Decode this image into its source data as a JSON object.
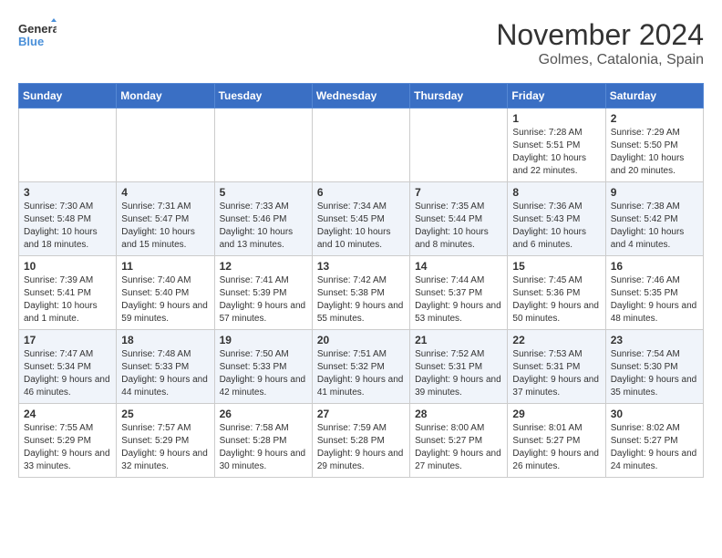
{
  "header": {
    "logo_line1": "General",
    "logo_line2": "Blue",
    "month": "November 2024",
    "location": "Golmes, Catalonia, Spain"
  },
  "weekdays": [
    "Sunday",
    "Monday",
    "Tuesday",
    "Wednesday",
    "Thursday",
    "Friday",
    "Saturday"
  ],
  "weeks": [
    [
      {
        "day": "",
        "content": ""
      },
      {
        "day": "",
        "content": ""
      },
      {
        "day": "",
        "content": ""
      },
      {
        "day": "",
        "content": ""
      },
      {
        "day": "",
        "content": ""
      },
      {
        "day": "1",
        "content": "Sunrise: 7:28 AM\nSunset: 5:51 PM\nDaylight: 10 hours and 22 minutes."
      },
      {
        "day": "2",
        "content": "Sunrise: 7:29 AM\nSunset: 5:50 PM\nDaylight: 10 hours and 20 minutes."
      }
    ],
    [
      {
        "day": "3",
        "content": "Sunrise: 7:30 AM\nSunset: 5:48 PM\nDaylight: 10 hours and 18 minutes."
      },
      {
        "day": "4",
        "content": "Sunrise: 7:31 AM\nSunset: 5:47 PM\nDaylight: 10 hours and 15 minutes."
      },
      {
        "day": "5",
        "content": "Sunrise: 7:33 AM\nSunset: 5:46 PM\nDaylight: 10 hours and 13 minutes."
      },
      {
        "day": "6",
        "content": "Sunrise: 7:34 AM\nSunset: 5:45 PM\nDaylight: 10 hours and 10 minutes."
      },
      {
        "day": "7",
        "content": "Sunrise: 7:35 AM\nSunset: 5:44 PM\nDaylight: 10 hours and 8 minutes."
      },
      {
        "day": "8",
        "content": "Sunrise: 7:36 AM\nSunset: 5:43 PM\nDaylight: 10 hours and 6 minutes."
      },
      {
        "day": "9",
        "content": "Sunrise: 7:38 AM\nSunset: 5:42 PM\nDaylight: 10 hours and 4 minutes."
      }
    ],
    [
      {
        "day": "10",
        "content": "Sunrise: 7:39 AM\nSunset: 5:41 PM\nDaylight: 10 hours and 1 minute."
      },
      {
        "day": "11",
        "content": "Sunrise: 7:40 AM\nSunset: 5:40 PM\nDaylight: 9 hours and 59 minutes."
      },
      {
        "day": "12",
        "content": "Sunrise: 7:41 AM\nSunset: 5:39 PM\nDaylight: 9 hours and 57 minutes."
      },
      {
        "day": "13",
        "content": "Sunrise: 7:42 AM\nSunset: 5:38 PM\nDaylight: 9 hours and 55 minutes."
      },
      {
        "day": "14",
        "content": "Sunrise: 7:44 AM\nSunset: 5:37 PM\nDaylight: 9 hours and 53 minutes."
      },
      {
        "day": "15",
        "content": "Sunrise: 7:45 AM\nSunset: 5:36 PM\nDaylight: 9 hours and 50 minutes."
      },
      {
        "day": "16",
        "content": "Sunrise: 7:46 AM\nSunset: 5:35 PM\nDaylight: 9 hours and 48 minutes."
      }
    ],
    [
      {
        "day": "17",
        "content": "Sunrise: 7:47 AM\nSunset: 5:34 PM\nDaylight: 9 hours and 46 minutes."
      },
      {
        "day": "18",
        "content": "Sunrise: 7:48 AM\nSunset: 5:33 PM\nDaylight: 9 hours and 44 minutes."
      },
      {
        "day": "19",
        "content": "Sunrise: 7:50 AM\nSunset: 5:33 PM\nDaylight: 9 hours and 42 minutes."
      },
      {
        "day": "20",
        "content": "Sunrise: 7:51 AM\nSunset: 5:32 PM\nDaylight: 9 hours and 41 minutes."
      },
      {
        "day": "21",
        "content": "Sunrise: 7:52 AM\nSunset: 5:31 PM\nDaylight: 9 hours and 39 minutes."
      },
      {
        "day": "22",
        "content": "Sunrise: 7:53 AM\nSunset: 5:31 PM\nDaylight: 9 hours and 37 minutes."
      },
      {
        "day": "23",
        "content": "Sunrise: 7:54 AM\nSunset: 5:30 PM\nDaylight: 9 hours and 35 minutes."
      }
    ],
    [
      {
        "day": "24",
        "content": "Sunrise: 7:55 AM\nSunset: 5:29 PM\nDaylight: 9 hours and 33 minutes."
      },
      {
        "day": "25",
        "content": "Sunrise: 7:57 AM\nSunset: 5:29 PM\nDaylight: 9 hours and 32 minutes."
      },
      {
        "day": "26",
        "content": "Sunrise: 7:58 AM\nSunset: 5:28 PM\nDaylight: 9 hours and 30 minutes."
      },
      {
        "day": "27",
        "content": "Sunrise: 7:59 AM\nSunset: 5:28 PM\nDaylight: 9 hours and 29 minutes."
      },
      {
        "day": "28",
        "content": "Sunrise: 8:00 AM\nSunset: 5:27 PM\nDaylight: 9 hours and 27 minutes."
      },
      {
        "day": "29",
        "content": "Sunrise: 8:01 AM\nSunset: 5:27 PM\nDaylight: 9 hours and 26 minutes."
      },
      {
        "day": "30",
        "content": "Sunrise: 8:02 AM\nSunset: 5:27 PM\nDaylight: 9 hours and 24 minutes."
      }
    ]
  ]
}
